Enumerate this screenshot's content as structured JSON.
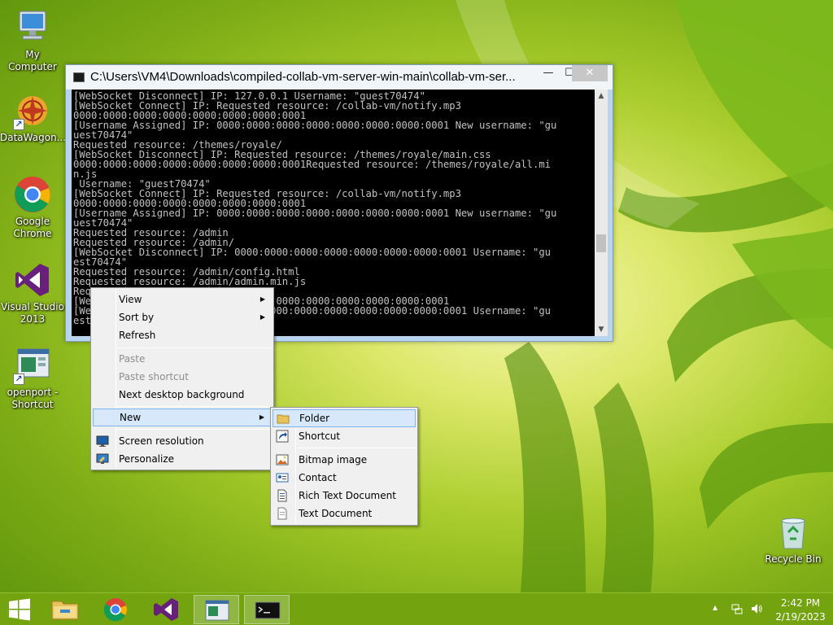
{
  "desktop": {
    "icons": [
      {
        "label": "My Computer"
      },
      {
        "label": "DataWagon..."
      },
      {
        "label": "Google Chrome"
      },
      {
        "label": "Visual Studio 2013"
      },
      {
        "label": "openport - Shortcut"
      },
      {
        "label": "Recycle Bin"
      }
    ]
  },
  "console": {
    "title": "C:\\Users\\VM4\\Downloads\\compiled-collab-vm-server-win-main\\collab-vm-ser...",
    "min_label": "—",
    "max_label": "☐",
    "close_label": "✕",
    "lines": [
      "[WebSocket Disconnect] IP: 127.0.0.1 Username: \"guest70474\"",
      "[WebSocket Connect] IP: Requested resource: /collab-vm/notify.mp3",
      "0000:0000:0000:0000:0000:0000:0000:0001",
      "[Username Assigned] IP: 0000:0000:0000:0000:0000:0000:0000:0001 New username: \"gu",
      "uest70474\"",
      "Requested resource: /themes/royale/",
      "[WebSocket Disconnect] IP: Requested resource: /themes/royale/main.css",
      "0000:0000:0000:0000:0000:0000:0000:0001Requested resource: /themes/royale/all.mi",
      "n.js",
      " Username: \"guest70474\"",
      "[WebSocket Connect] IP: Requested resource: /collab-vm/notify.mp3",
      "0000:0000:0000:0000:0000:0000:0000:0001",
      "[Username Assigned] IP: 0000:0000:0000:0000:0000:0000:0000:0001 New username: \"gu",
      "uest70474\"",
      "Requested resource: /admin",
      "Requested resource: /admin/",
      "[WebSocket Disconnect] IP: 0000:0000:0000:0000:0000:0000:0000:0001 Username: \"gu",
      "est70474\"",
      "Requested resource: /admin/config.html",
      "Requested resource: /admin/admin.min.js",
      "Requested resource: /admin/",
      "[WebSocket Connect] IP: 0000:0000:0000:0000:0000:0000:0000:0001",
      "[WebSocket Disconnect] IP: 0000:0000:0000:0000:0000:0000:0000:0001 Username: \"gu",
      "est70474\""
    ]
  },
  "context_menu": {
    "items": [
      {
        "label": "View"
      },
      {
        "label": "Sort by"
      },
      {
        "label": "Refresh"
      },
      {
        "label": "Paste"
      },
      {
        "label": "Paste shortcut"
      },
      {
        "label": "Next desktop background"
      },
      {
        "label": "New"
      },
      {
        "label": "Screen resolution"
      },
      {
        "label": "Personalize"
      }
    ]
  },
  "new_submenu": {
    "items": [
      {
        "label": "Folder"
      },
      {
        "label": "Shortcut"
      },
      {
        "label": "Bitmap image"
      },
      {
        "label": "Contact"
      },
      {
        "label": "Rich Text Document"
      },
      {
        "label": "Text Document"
      }
    ]
  },
  "taskbar": {
    "time": "2:42 PM",
    "date": "2/19/2023",
    "tray_expand": "▲"
  },
  "colors": {
    "taskbar": "#73a30f",
    "menu_bg": "#f0f0f0",
    "menu_highlight": "#d6e8f9",
    "console_bg": "#000000",
    "console_text": "#c0c0c0"
  }
}
